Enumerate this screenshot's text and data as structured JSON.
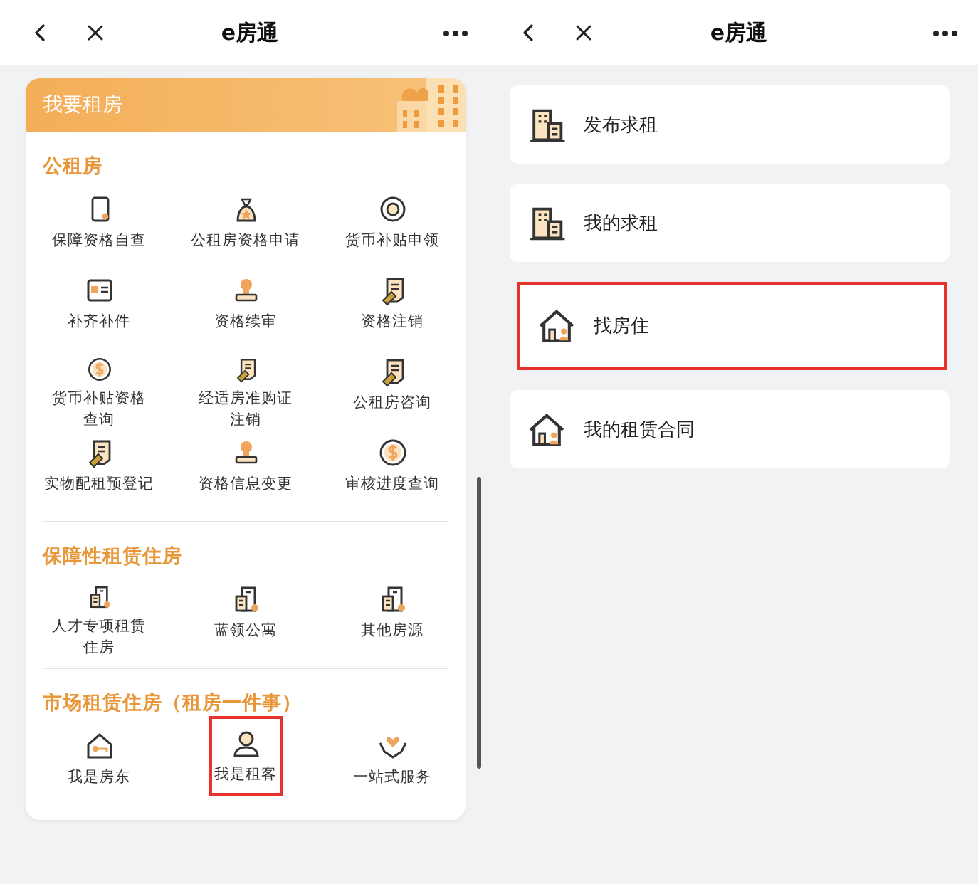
{
  "screens": [
    {
      "title": "e房通",
      "kind": "services",
      "banner": "我要租房",
      "sections": [
        {
          "title": "公租房",
          "items": [
            {
              "lines": [
                "保障资格自查"
              ],
              "kind": "document",
              "highlighted": false
            },
            {
              "lines": [
                "公租房资格申请"
              ],
              "kind": "moneybag",
              "highlighted": false
            },
            {
              "lines": [
                "货币补贴申领"
              ],
              "kind": "coin",
              "highlighted": false
            },
            {
              "lines": [
                "补齐补件"
              ],
              "kind": "card",
              "highlighted": false
            },
            {
              "lines": [
                "资格续审"
              ],
              "kind": "stamp",
              "highlighted": false
            },
            {
              "lines": [
                "资格注销"
              ],
              "kind": "certificate",
              "highlighted": false
            },
            {
              "lines": [
                "货币补贴资格",
                "查询"
              ],
              "kind": "dollar",
              "highlighted": false
            },
            {
              "lines": [
                "经适房准购证",
                "注销"
              ],
              "kind": "certificate",
              "highlighted": false
            },
            {
              "lines": [
                "公租房咨询"
              ],
              "kind": "certificate",
              "highlighted": false
            },
            {
              "lines": [
                "实物配租预登记"
              ],
              "kind": "certificate",
              "highlighted": false
            },
            {
              "lines": [
                "资格信息变更"
              ],
              "kind": "stamp",
              "highlighted": false
            },
            {
              "lines": [
                "审核进度查询"
              ],
              "kind": "dollar",
              "highlighted": false
            }
          ]
        },
        {
          "title": "保障性租赁住房",
          "items": [
            {
              "lines": [
                "人才专项租赁",
                "住房"
              ],
              "kind": "building",
              "highlighted": false
            },
            {
              "lines": [
                "蓝领公寓"
              ],
              "kind": "building",
              "highlighted": false
            },
            {
              "lines": [
                "其他房源"
              ],
              "kind": "building",
              "highlighted": false
            }
          ]
        },
        {
          "title": "市场租赁住房（租房一件事）",
          "items": [
            {
              "lines": [
                "我是房东"
              ],
              "kind": "housekey",
              "highlighted": false
            },
            {
              "lines": [
                "我是租客"
              ],
              "kind": "person",
              "highlighted": true
            },
            {
              "lines": [
                "一站式服务"
              ],
              "kind": "hearthands",
              "highlighted": false
            }
          ]
        }
      ]
    },
    {
      "title": "e房通",
      "kind": "list",
      "entries": [
        {
          "label": "发布求租",
          "kind": "tower",
          "highlighted": false
        },
        {
          "label": "我的求租",
          "kind": "tower",
          "highlighted": false
        },
        {
          "label": "找房住",
          "kind": "home",
          "highlighted": true
        },
        {
          "label": "我的租赁合同",
          "kind": "home",
          "highlighted": false
        }
      ]
    }
  ]
}
